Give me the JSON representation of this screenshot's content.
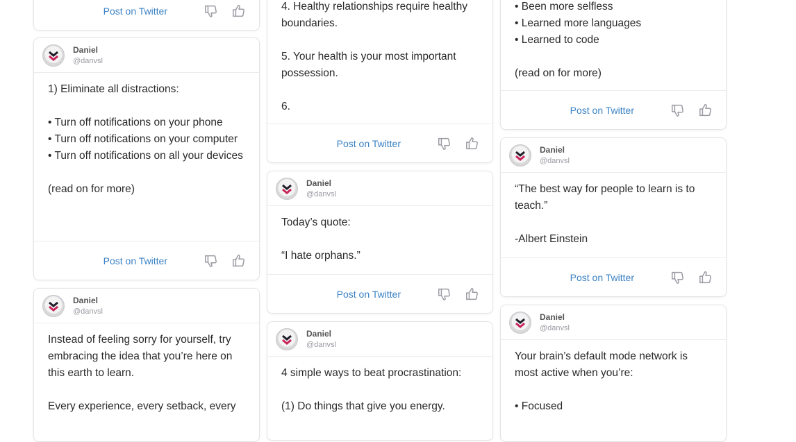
{
  "author": {
    "name": "Daniel",
    "handle": "@danvsl"
  },
  "actions": {
    "post": "Post on Twitter"
  },
  "icons": {
    "avatar": "chevron-logo-icon",
    "dislike": "thumbs-down-icon",
    "like": "thumbs-up-icon"
  },
  "colors": {
    "link": "#3b82c4",
    "border": "#e4e4e8"
  },
  "columns": [
    {
      "cards": [
        {
          "header": false,
          "body": ""
        },
        {
          "header": true,
          "body": "1) Eliminate all distractions:\n\n• Turn off notifications on your phone\n• Turn off notifications on your computer\n• Turn off notifications on all your devices\n\n(read on for more)"
        },
        {
          "header": true,
          "body": "Instead of feeling sorry for yourself, try embracing the idea that you’re here on this earth to learn.\n\nEvery experience, every setback, every"
        }
      ]
    },
    {
      "cards": [
        {
          "header": false,
          "body": "4. Healthy relationships require healthy boundaries.\n\n5. Your health is your most important possession.\n\n6."
        },
        {
          "header": true,
          "body": "Today’s quote:\n\n“I hate orphans.”"
        },
        {
          "header": true,
          "body": "4 simple ways to beat procrastination:\n\n(1) Do things that give you energy."
        }
      ]
    },
    {
      "cards": [
        {
          "header": false,
          "body": "• Been more selfless\n• Learned more languages\n• Learned to code\n\n(read on for more)"
        },
        {
          "header": true,
          "body": "“The best way for people to learn is to teach.”\n\n-Albert Einstein"
        },
        {
          "header": true,
          "body": "Your brain’s default mode network is most active when you’re:\n\n• Focused"
        }
      ]
    }
  ]
}
